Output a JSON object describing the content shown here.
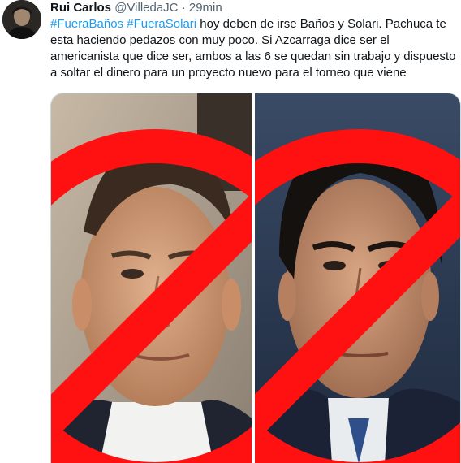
{
  "tweet": {
    "author_name": "Rui Carlos",
    "handle": "@VilledaJC",
    "separator": "·",
    "time": "29min",
    "hashtags": [
      "#FueraBaños",
      "#FueraSolari"
    ],
    "text": "hoy deben de irse Baños y Solari. Pachuca te esta haciendo pedazos con muy poco. Si Azcarraga dice ser el americanista que dice ser, ambos a las 6 se quedan sin trabajo y dispuesto a soltar el dinero para un proyecto nuevo para el torneo que viene"
  },
  "media": {
    "photos": [
      {
        "subject": "man with short receding hair, crossed out",
        "icon": "prohibition-sign"
      },
      {
        "subject": "man with dark slicked hair, crossed out",
        "icon": "prohibition-sign"
      }
    ],
    "prohibition_color": "#ff1111"
  },
  "colors": {
    "link": "#1d9bf0",
    "text": "#0f1419",
    "secondary": "#536471"
  }
}
